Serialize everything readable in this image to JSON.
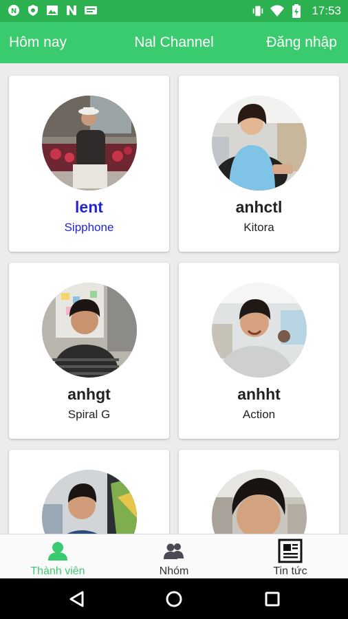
{
  "status_bar": {
    "time": "17:53",
    "left_icons": [
      "circle-n-icon",
      "shield-icon",
      "image-icon",
      "n-logo-icon",
      "message-icon"
    ],
    "right_icons": [
      "vibrate-icon",
      "wifi-icon",
      "battery-icon"
    ]
  },
  "header": {
    "left_label": "Hôm nay",
    "title": "Nal Channel",
    "right_label": "Đăng nhập"
  },
  "members": [
    {
      "username": "lent",
      "group": "Sipphone",
      "selected": true
    },
    {
      "username": "anhctl",
      "group": "Kitora",
      "selected": false
    },
    {
      "username": "anhgt",
      "group": "Spiral G",
      "selected": false
    },
    {
      "username": "anhht",
      "group": "Action",
      "selected": false
    },
    {
      "username": "",
      "group": "",
      "selected": false
    },
    {
      "username": "",
      "group": "",
      "selected": false
    }
  ],
  "bottom_nav": [
    {
      "label": "Thành viên",
      "icon": "person-icon",
      "active": true
    },
    {
      "label": "Nhóm",
      "icon": "group-icon",
      "active": false
    },
    {
      "label": "Tin tức",
      "icon": "news-icon",
      "active": false
    }
  ],
  "colors": {
    "status_bar": "#2bb150",
    "app_bar": "#3bcb6f",
    "selected_text": "#2323d6",
    "active_nav": "#3bcb6f"
  }
}
